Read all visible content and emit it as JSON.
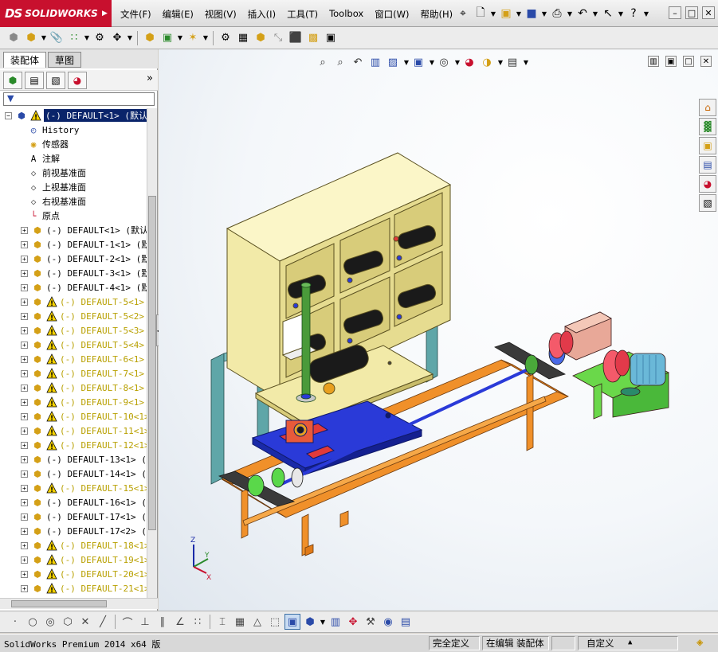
{
  "app": {
    "logo_ds": "DS",
    "logo_name": "SOLIDWORKS"
  },
  "menu": [
    "文件(F)",
    "编辑(E)",
    "视图(V)",
    "插入(I)",
    "工具(T)",
    "Toolbox",
    "窗口(W)",
    "帮助(H)"
  ],
  "panel": {
    "tabs": [
      "装配体",
      "草图"
    ],
    "filter_icon": "funnel-icon",
    "more": "»",
    "tree": [
      {
        "label": "(-) DEFAULT<1> (默认",
        "kind": "root",
        "warn": true,
        "selected": true
      },
      {
        "label": "History",
        "kind": "history"
      },
      {
        "label": "传感器",
        "kind": "sensor"
      },
      {
        "label": "注解",
        "kind": "annotation"
      },
      {
        "label": "前视基准面",
        "kind": "plane"
      },
      {
        "label": "上视基准面",
        "kind": "plane"
      },
      {
        "label": "右视基准面",
        "kind": "plane"
      },
      {
        "label": "原点",
        "kind": "origin"
      },
      {
        "label": "(-) DEFAULT<1> (默认",
        "kind": "comp"
      },
      {
        "label": "(-) DEFAULT-1<1> (默",
        "kind": "comp"
      },
      {
        "label": "(-) DEFAULT-2<1> (默",
        "kind": "comp"
      },
      {
        "label": "(-) DEFAULT-3<1> (默",
        "kind": "comp"
      },
      {
        "label": "(-) DEFAULT-4<1> (默",
        "kind": "comp"
      },
      {
        "label": "(-) DEFAULT-5<1>",
        "kind": "comp",
        "warn": true,
        "yellow": true
      },
      {
        "label": "(-) DEFAULT-5<2>",
        "kind": "comp",
        "warn": true,
        "yellow": true
      },
      {
        "label": "(-) DEFAULT-5<3>",
        "kind": "comp",
        "warn": true,
        "yellow": true
      },
      {
        "label": "(-) DEFAULT-5<4>",
        "kind": "comp",
        "warn": true,
        "yellow": true
      },
      {
        "label": "(-) DEFAULT-6<1>",
        "kind": "comp",
        "warn": true,
        "yellow": true
      },
      {
        "label": "(-) DEFAULT-7<1>",
        "kind": "comp",
        "warn": true,
        "yellow": true
      },
      {
        "label": "(-) DEFAULT-8<1>",
        "kind": "comp",
        "warn": true,
        "yellow": true
      },
      {
        "label": "(-) DEFAULT-9<1>",
        "kind": "comp",
        "warn": true,
        "yellow": true
      },
      {
        "label": "(-) DEFAULT-10<1>",
        "kind": "comp",
        "warn": true,
        "yellow": true
      },
      {
        "label": "(-) DEFAULT-11<1>",
        "kind": "comp",
        "warn": true,
        "yellow": true
      },
      {
        "label": "(-) DEFAULT-12<1>",
        "kind": "comp",
        "warn": true,
        "yellow": true
      },
      {
        "label": "(-) DEFAULT-13<1> (默",
        "kind": "comp"
      },
      {
        "label": "(-) DEFAULT-14<1> (默",
        "kind": "comp"
      },
      {
        "label": "(-) DEFAULT-15<1>",
        "kind": "comp",
        "warn": true,
        "yellow": true
      },
      {
        "label": "(-) DEFAULT-16<1> (默",
        "kind": "comp"
      },
      {
        "label": "(-) DEFAULT-17<1> (默",
        "kind": "comp"
      },
      {
        "label": "(-) DEFAULT-17<2> (默",
        "kind": "comp"
      },
      {
        "label": "(-) DEFAULT-18<1>",
        "kind": "comp",
        "warn": true,
        "yellow": true
      },
      {
        "label": "(-) DEFAULT-19<1>",
        "kind": "comp",
        "warn": true,
        "yellow": true
      },
      {
        "label": "(-) DEFAULT-20<1>",
        "kind": "comp",
        "warn": true,
        "yellow": true
      },
      {
        "label": "(-) DEFAULT-21<1>",
        "kind": "comp",
        "warn": true,
        "yellow": true
      }
    ]
  },
  "triad": {
    "x": "X",
    "y": "Y",
    "z": "Z"
  },
  "status": {
    "product": "SolidWorks Premium 2014 x64 版",
    "defined": "完全定义",
    "editing": "在编辑 装配体",
    "units": "自定义"
  },
  "colors": {
    "cabinet": "#f2eaa8",
    "frame_cyan": "#5fa6a8",
    "frame_orange": "#f0902a",
    "table_blue": "#2a3ad8",
    "motor_green": "#6ad84a",
    "column_green": "#4a9a3a",
    "belt": "#1a1a1a",
    "gear_red": "#e23a3a"
  }
}
